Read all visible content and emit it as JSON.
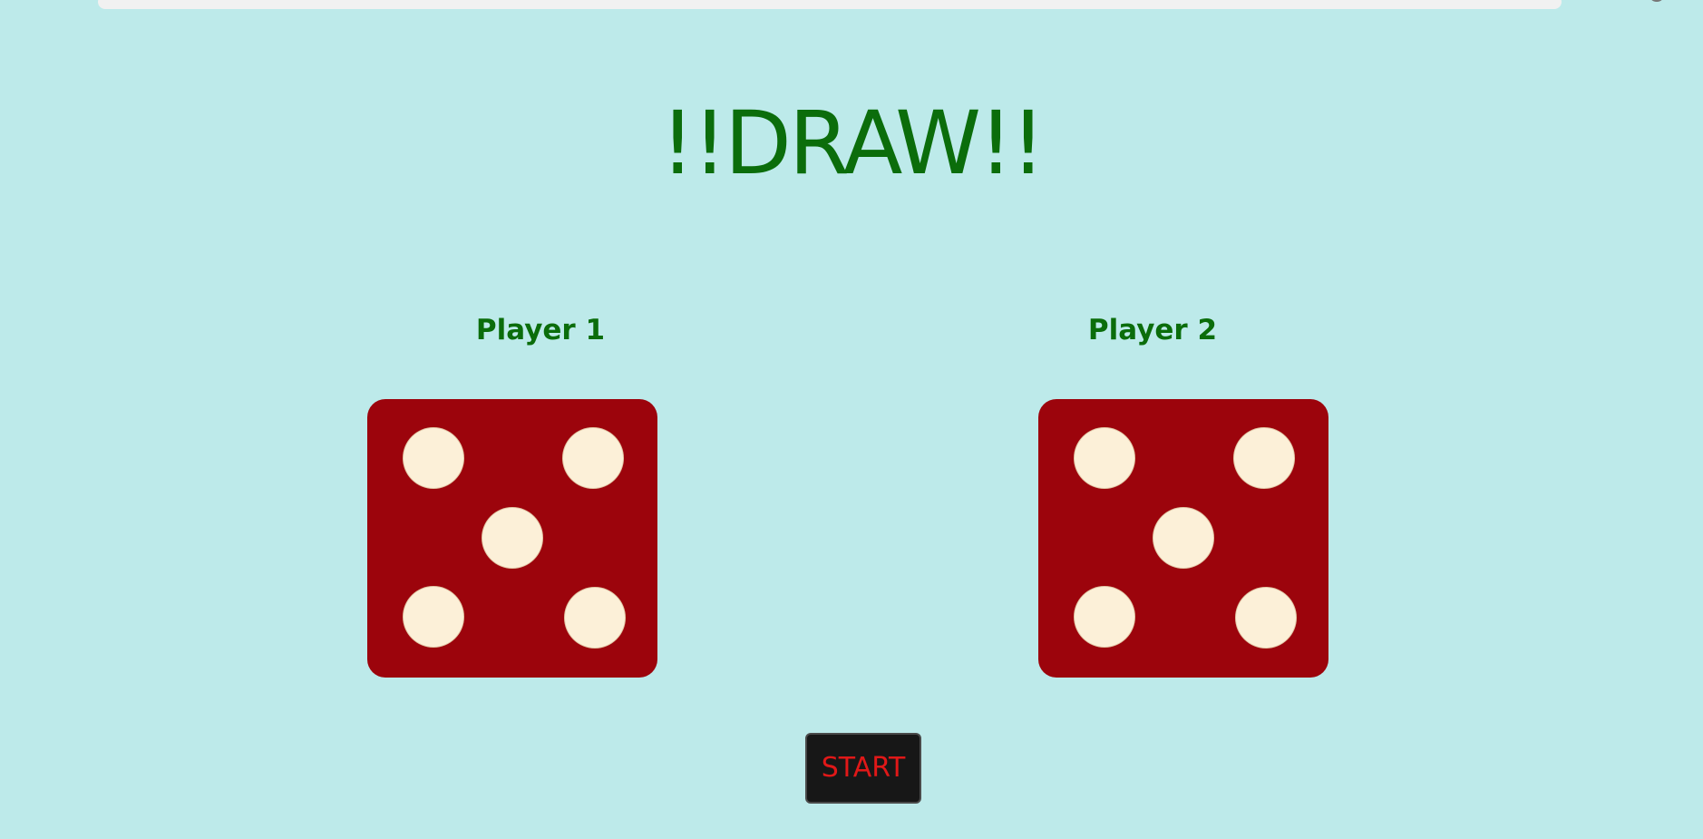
{
  "header": {
    "title": "!!DRAW!!"
  },
  "players": [
    {
      "label": "Player 1",
      "die_value": 5
    },
    {
      "label": "Player 2",
      "die_value": 5
    }
  ],
  "controls": {
    "start_label": "START"
  },
  "colors": {
    "background": "#bdeaea",
    "title": "#0b6d0b",
    "die_face": "#9c040c",
    "pip": "#fcf0d8",
    "button_bg": "#171717",
    "button_text": "#e01818"
  }
}
